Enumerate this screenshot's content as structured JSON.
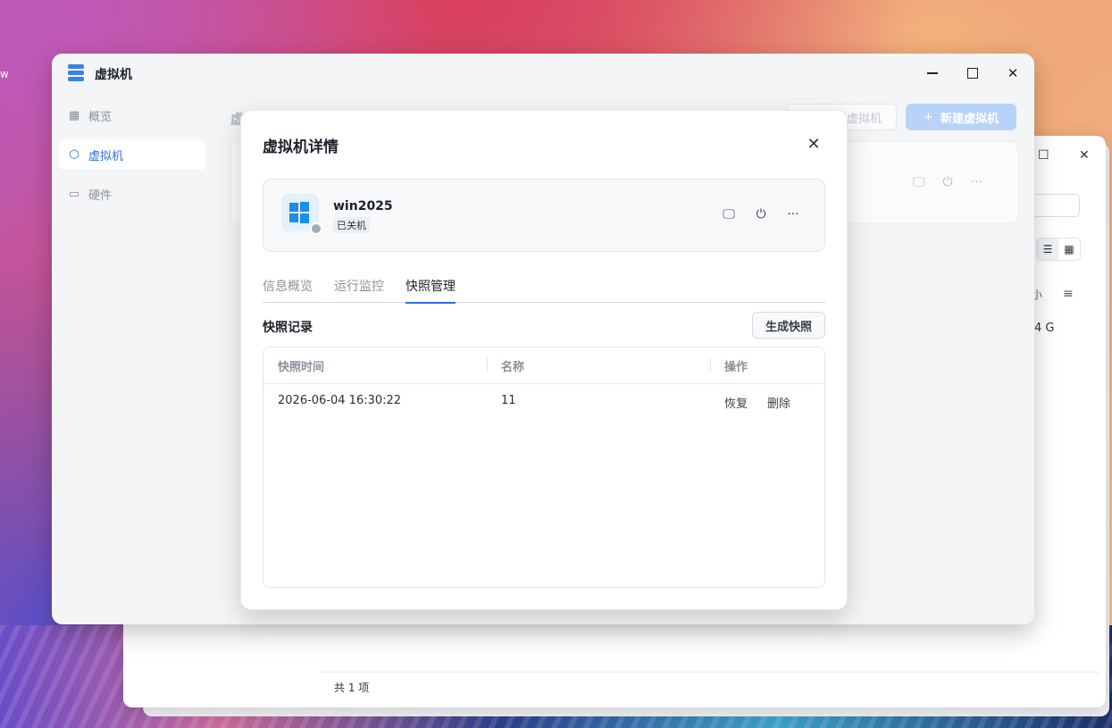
{
  "desktop": {
    "edge_text": "w"
  },
  "background_window": {
    "maximize_glyph": "☐",
    "close_glyph": "✕",
    "list_view_glyph": "☰",
    "grid_view_glyph": "▦",
    "column_partial": "小",
    "filter_glyph": "≡",
    "size_partial": "4 G",
    "footer_total": "共 1 项"
  },
  "app": {
    "title": "虚拟机",
    "window_controls": {
      "close": "✕"
    },
    "sidebar": {
      "items": [
        {
          "label": "概览",
          "icon": "grid-icon",
          "glyph": "▦",
          "active": false
        },
        {
          "label": "虚拟机",
          "icon": "cube-icon",
          "glyph": "⬡",
          "active": true
        },
        {
          "label": "硬件",
          "icon": "disk-icon",
          "glyph": "▭",
          "active": false
        }
      ]
    },
    "content": {
      "title_partial": "虚",
      "import_button_partial": "虚拟机",
      "new_button": {
        "plus": "+",
        "label": "新建虚拟机"
      },
      "card_icons": [
        "🖵",
        "⏻",
        "···"
      ]
    }
  },
  "dialog": {
    "title": "虚拟机详情",
    "close": "✕",
    "vm": {
      "name": "win2025",
      "status": "已关机",
      "actions": {
        "console": "🖵",
        "power": "⏻",
        "more": "···"
      }
    },
    "tabs": [
      {
        "label": "信息概览",
        "active": false
      },
      {
        "label": "运行监控",
        "active": false
      },
      {
        "label": "快照管理",
        "active": true
      }
    ],
    "section_title": "快照记录",
    "create_snapshot_button": "生成快照",
    "table": {
      "columns": [
        "快照时间",
        "名称",
        "操作"
      ],
      "rows": [
        {
          "time": "2026-06-04 16:30:22",
          "name": "11",
          "actions": [
            "恢复",
            "删除"
          ]
        }
      ]
    }
  },
  "colors": {
    "accent": "#2f6fe0",
    "primary_disabled": "#b9d2f7",
    "windows_logo": "#1a8fe3",
    "status_off": "#a3acb9"
  }
}
